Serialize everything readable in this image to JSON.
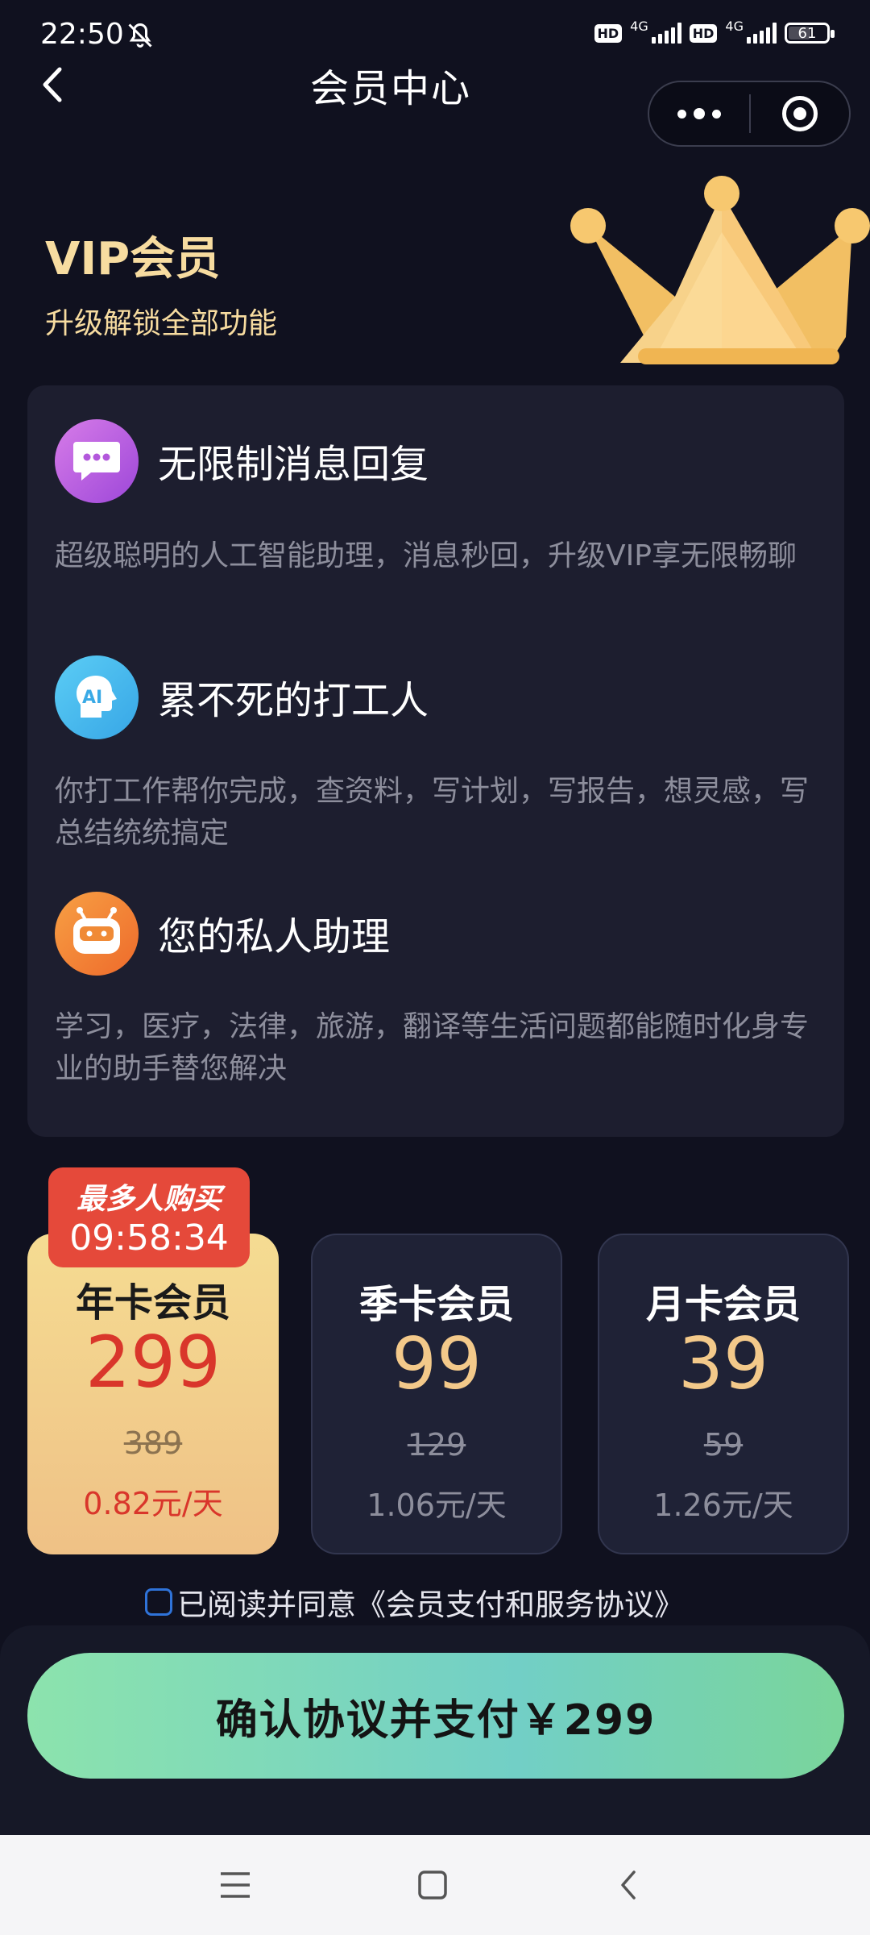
{
  "status_bar": {
    "time": "22:50",
    "sim1_badge": "HD",
    "sim1_network": "4G",
    "sim2_badge": "HD",
    "sim2_network": "4G",
    "battery": "61",
    "battery_level": 0.61,
    "icons": [
      "bell-off-icon",
      "signal-icon",
      "battery-icon"
    ]
  },
  "header": {
    "title": "会员中心",
    "back_icon": "chevron-left-icon",
    "more_icon": "more-dots-icon",
    "close_icon": "target-icon"
  },
  "hero": {
    "title": "VIP会员",
    "subtitle": "升级解锁全部功能",
    "illustration": "crown-icon"
  },
  "features": [
    {
      "title": "无限制消息回复",
      "description": "超级聪明的人工智能助理，消息秒回，升级VIP享无限畅聊",
      "icon": "message-icon"
    },
    {
      "title": "累不死的打工人",
      "description": "你打工作帮你完成，查资料，写计划，写报告，想灵感，写总结统统搞定",
      "icon": "ai-head-icon",
      "icon_text": "AI"
    },
    {
      "title": "您的私人助理",
      "description": "学习，医疗，法律，旅游，翻译等生活问题都能随时化身专业的助手替您解决",
      "icon": "robot-icon"
    }
  ],
  "promo": {
    "label": "最多人购买",
    "timer": "09:58:34"
  },
  "plans": [
    {
      "name": "年卡会员",
      "price": "299",
      "original_price": "389",
      "daily": "0.82元/天",
      "selected": true
    },
    {
      "name": "季卡会员",
      "price": "99",
      "original_price": "129",
      "daily": "1.06元/天",
      "selected": false
    },
    {
      "name": "月卡会员",
      "price": "39",
      "original_price": "59",
      "daily": "1.26元/天",
      "selected": false
    }
  ],
  "agreement": {
    "text": "已阅读并同意《会员支付和服务协议》",
    "checked": false
  },
  "pay_button": {
    "label": "确认协议并支付￥299"
  },
  "nav": {
    "icons": [
      "menu-icon",
      "home-square-icon",
      "back-triangle-icon"
    ]
  },
  "colors": {
    "background": "#10111f",
    "card": "#1d1e2f",
    "gold": "#f7dca0",
    "red": "#d9362b",
    "pay_gradient_start": "#8ce3ad",
    "pay_gradient_end": "#72cfc6"
  }
}
